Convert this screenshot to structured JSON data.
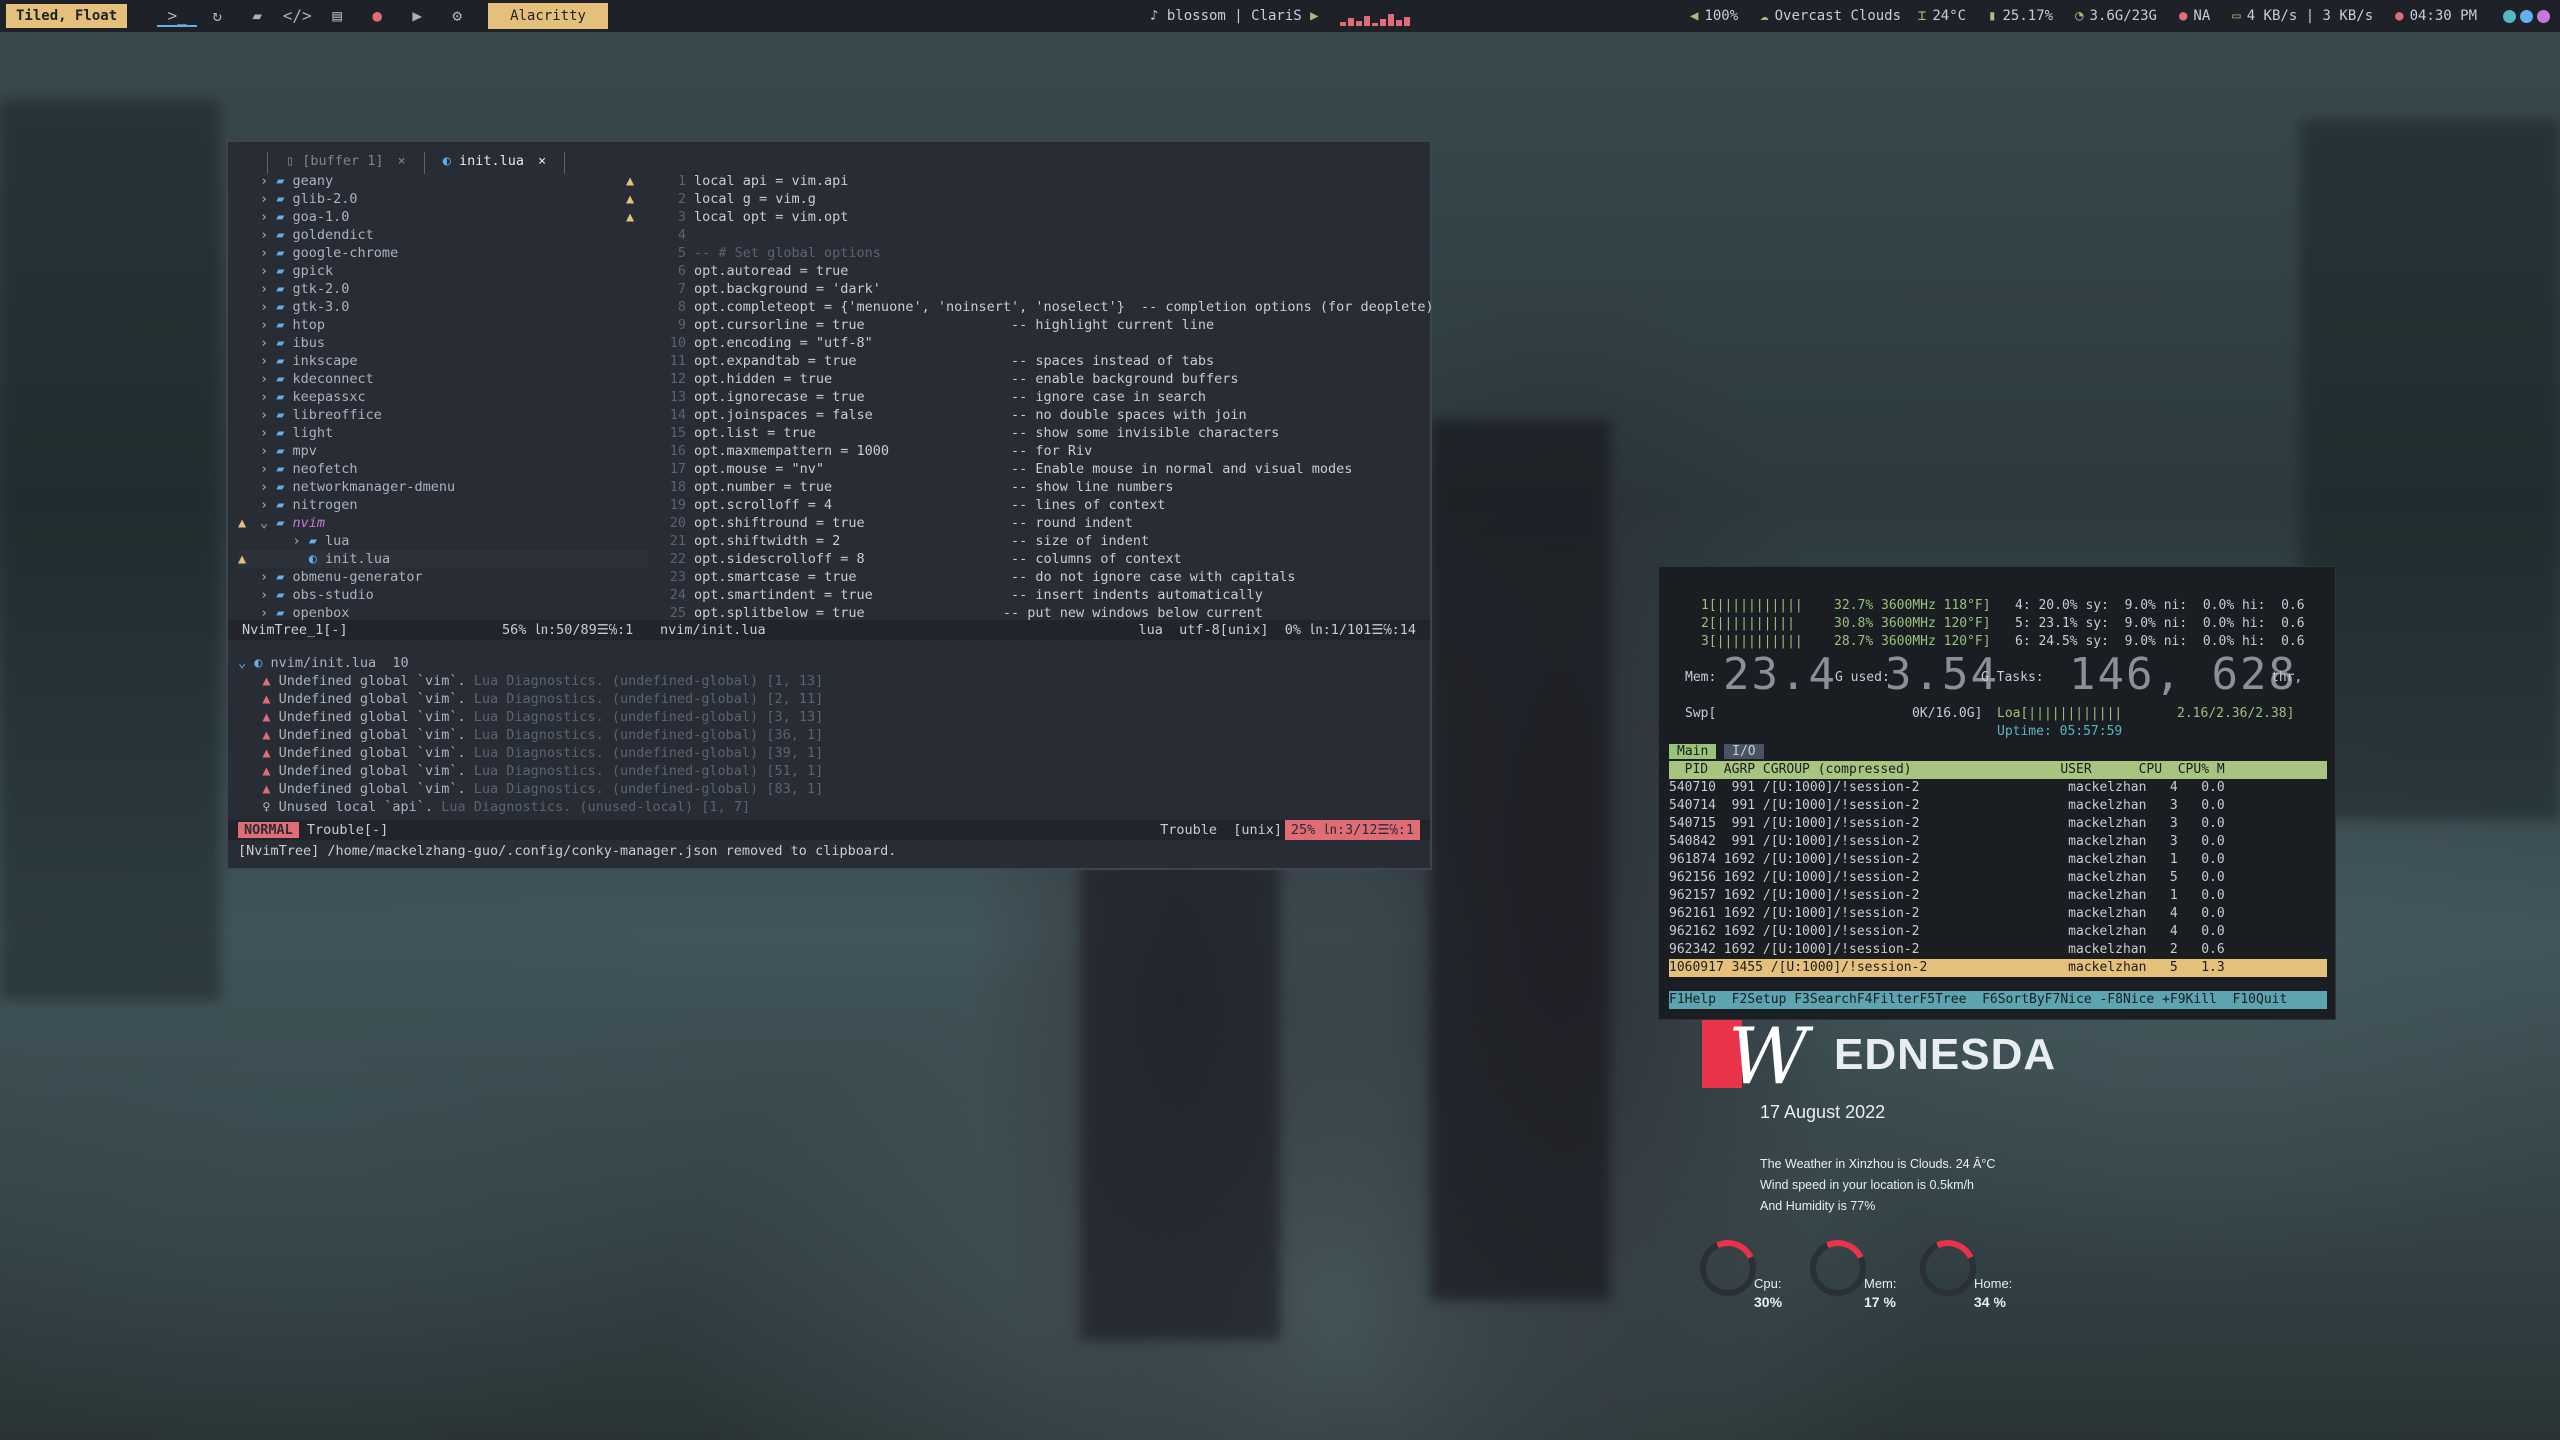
{
  "bar": {
    "layout": "Tiled, Float",
    "active_window": "Alacritty",
    "media": "♪ blossom | ClariS",
    "volume": "100%",
    "weather": "Overcast Clouds",
    "temp": "24°C",
    "battery": "25.17%",
    "memory": "3.6G/23G",
    "network": "NA",
    "speed": "4 KB/s | 3 KB/s",
    "clock": "04:30 PM",
    "icons": [
      "terminal-icon",
      "refresh-icon",
      "folder-icon",
      "code-icon",
      "book-icon",
      "chat-icon",
      "youtube-icon",
      "gear-icon"
    ]
  },
  "nvim": {
    "tabs": [
      {
        "label": "[buffer 1]"
      },
      {
        "label": "init.lua"
      }
    ],
    "tree": [
      {
        "name": "geany"
      },
      {
        "name": "glib-2.0"
      },
      {
        "name": "goa-1.0"
      },
      {
        "name": "goldendict"
      },
      {
        "name": "google-chrome"
      },
      {
        "name": "gpick"
      },
      {
        "name": "gtk-2.0"
      },
      {
        "name": "gtk-3.0"
      },
      {
        "name": "htop"
      },
      {
        "name": "ibus"
      },
      {
        "name": "inkscape"
      },
      {
        "name": "kdeconnect"
      },
      {
        "name": "keepassxc"
      },
      {
        "name": "libreoffice"
      },
      {
        "name": "light"
      },
      {
        "name": "mpv"
      },
      {
        "name": "neofetch"
      },
      {
        "name": "networkmanager-dmenu"
      },
      {
        "name": "nitrogen"
      },
      {
        "name": "nvim"
      },
      {
        "name": "lua"
      },
      {
        "name": "init.lua"
      },
      {
        "name": "obmenu-generator"
      },
      {
        "name": "obs-studio"
      },
      {
        "name": "openbox"
      }
    ],
    "code": [
      "local api = vim.api",
      "local g = vim.g",
      "local opt = vim.opt",
      "",
      "-- # Set global options",
      "opt.autoread = true",
      "opt.background = 'dark'",
      "opt.completeopt = {'menuone', 'noinsert', 'noselect'}  -- completion options (for deoplete)",
      "opt.cursorline = true                  -- highlight current line",
      "opt.encoding = \"utf-8\"",
      "opt.expandtab = true                   -- spaces instead of tabs",
      "opt.hidden = true                      -- enable background buffers",
      "opt.ignorecase = true                  -- ignore case in search",
      "opt.joinspaces = false                 -- no double spaces with join",
      "opt.list = true                        -- show some invisible characters",
      "opt.maxmempattern = 1000               -- for Riv",
      "opt.mouse = \"nv\"                       -- Enable mouse in normal and visual modes",
      "opt.number = true                      -- show line numbers",
      "opt.scrolloff = 4                      -- lines of context",
      "opt.shiftround = true                  -- round indent",
      "opt.shiftwidth = 2                     -- size of indent",
      "opt.sidescrolloff = 8                  -- columns of context",
      "opt.smartcase = true                   -- do not ignore case with capitals",
      "opt.smartindent = true                 -- insert indents automatically",
      "opt.splitbelow = true                 -- put new windows below current"
    ],
    "status_left": "NvimTree_1[-]",
    "status_tree_pos": "56% ㏑:50/89☰℅:1",
    "status_file": "nvim/init.lua",
    "status_right": "lua  utf-8[unix]  0% ㏑:1/101☰℅:14",
    "trouble_header": "nvim/init.lua  10",
    "trouble": [
      {
        "msg": "Undefined global `vim`.",
        "src": "Lua Diagnostics. (undefined-global) [1, 13]"
      },
      {
        "msg": "Undefined global `vim`.",
        "src": "Lua Diagnostics. (undefined-global) [2, 11]"
      },
      {
        "msg": "Undefined global `vim`.",
        "src": "Lua Diagnostics. (undefined-global) [3, 13]"
      },
      {
        "msg": "Undefined global `vim`.",
        "src": "Lua Diagnostics. (undefined-global) [36, 1]"
      },
      {
        "msg": "Undefined global `vim`.",
        "src": "Lua Diagnostics. (undefined-global) [39, 1]"
      },
      {
        "msg": "Undefined global `vim`.",
        "src": "Lua Diagnostics. (undefined-global) [51, 1]"
      },
      {
        "msg": "Undefined global `vim`.",
        "src": "Lua Diagnostics. (undefined-global) [83, 1]"
      },
      {
        "msg": "Unused local `api`.",
        "src": "Lua Diagnostics. (unused-local) [1, 7]"
      }
    ],
    "mode": "NORMAL",
    "trouble_buf": "Trouble[-]",
    "trouble_right": "Trouble  [unix]",
    "trouble_pos": "25% ㏑:3/12☰℅:1",
    "message": "[NvimTree] /home/mackelzhang-guo/.config/conky-manager.json removed to clipboard."
  },
  "htop": {
    "cpu1": "1[|||||||||||    32.7% 3600MHz 118°F]",
    "cpu2": "2[||||||||||     30.8% 3600MHz 120°F]",
    "cpu3": "3[|||||||||||    28.7% 3600MHz 120°F]",
    "cpu4": "4: 20.0% sy:  9.0% ni:  0.0% hi:  0.6",
    "cpu5": "5: 23.1% sy:  9.0% ni:  0.0% hi:  0.6",
    "cpu6": "6: 24.5% sy:  9.0% ni:  0.0% hi:  0.6",
    "mem_label": "Mem:",
    "mem_total": "23.4",
    "mem_used_label": "G used:",
    "mem_used": "3.54",
    "tasks_label": "G Tasks:",
    "tasks": "146, 628",
    "thr": "thr,",
    "swp": "Swp[                         0K/16.0G]",
    "load": "Loa[||||||||||||       2.16/2.36/2.38]",
    "uptime": "Uptime: 05:57:59",
    "tabs": [
      "Main",
      "I/O"
    ],
    "header": "  PID  AGRP CGROUP (compressed)                   USER      CPU  CPU% M",
    "rows": [
      "540710  991 /[U:1000]/!session-2                   mackelzhan   4   0.0",
      "540714  991 /[U:1000]/!session-2                   mackelzhan   3   0.0",
      "540715  991 /[U:1000]/!session-2                   mackelzhan   3   0.0",
      "540842  991 /[U:1000]/!session-2                   mackelzhan   3   0.0",
      "961874 1692 /[U:1000]/!session-2                   mackelzhan   1   0.0",
      "962156 1692 /[U:1000]/!session-2                   mackelzhan   5   0.0",
      "962157 1692 /[U:1000]/!session-2                   mackelzhan   1   0.0",
      "962161 1692 /[U:1000]/!session-2                   mackelzhan   4   0.0",
      "962162 1692 /[U:1000]/!session-2                   mackelzhan   4   0.0",
      "962342 1692 /[U:1000]/!session-2                   mackelzhan   2   0.6",
      "1060917 3455 /[U:1000]/!session-2                  mackelzhan   5   1.3"
    ],
    "fkeys": "F1Help  F2Setup F3SearchF4FilterF5Tree  F6SortByF7Nice -F8Nice +F9Kill  F10Quit"
  },
  "conky": {
    "letter": "W",
    "day": "EDNESDA",
    "date": "17 August 2022",
    "weather1": "The Weather in Xinzhou is Clouds. 24 Â°C",
    "weather2": "Wind speed in your location is 0.5km/h",
    "weather3": "And Humidity is 77%",
    "gauges": [
      {
        "label": "Cpu:",
        "value": "30%"
      },
      {
        "label": "Mem:",
        "value": "17 %"
      },
      {
        "label": "Home:",
        "value": "34 %"
      }
    ]
  },
  "colors": {
    "accent": "#e5c07b",
    "red": "#e8334a",
    "bg": "#282c34"
  }
}
